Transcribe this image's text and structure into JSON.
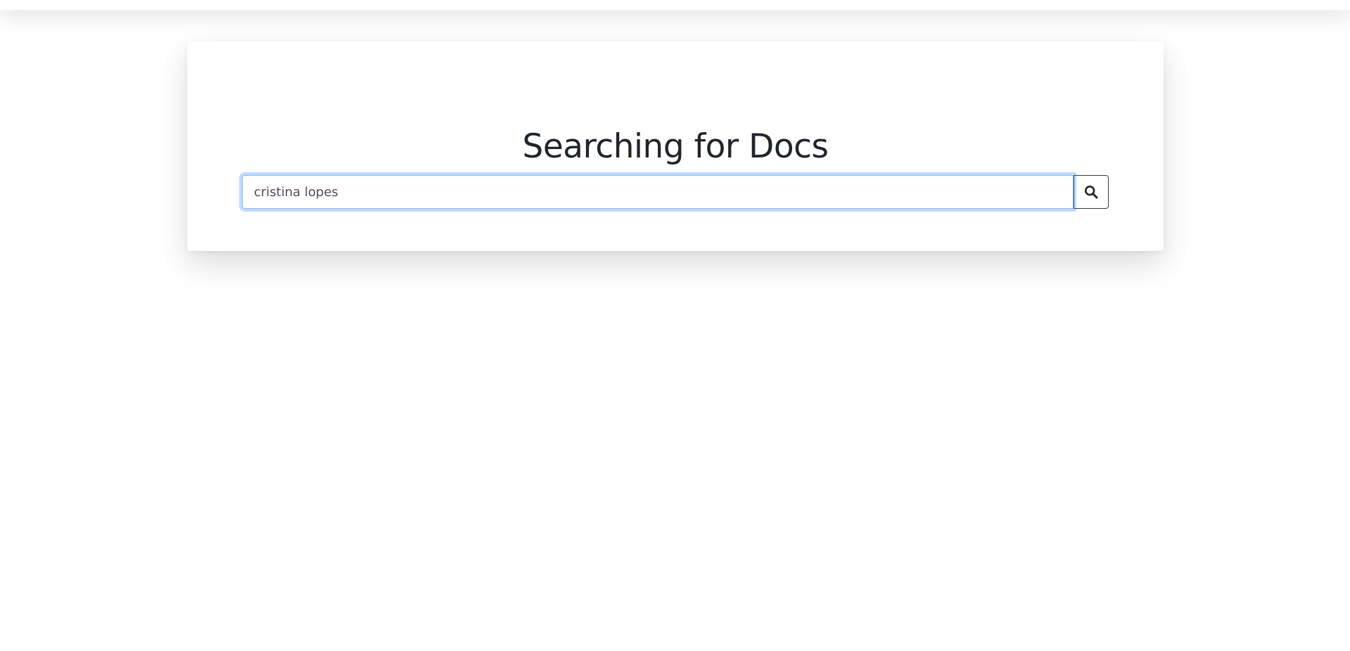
{
  "header": {
    "title": "Searching for Docs"
  },
  "search": {
    "value": "cristina lopes",
    "button_icon": "search-icon"
  },
  "colors": {
    "focus_border": "#86b7fe",
    "button_border": "#343a40",
    "title_text": "#212529"
  }
}
